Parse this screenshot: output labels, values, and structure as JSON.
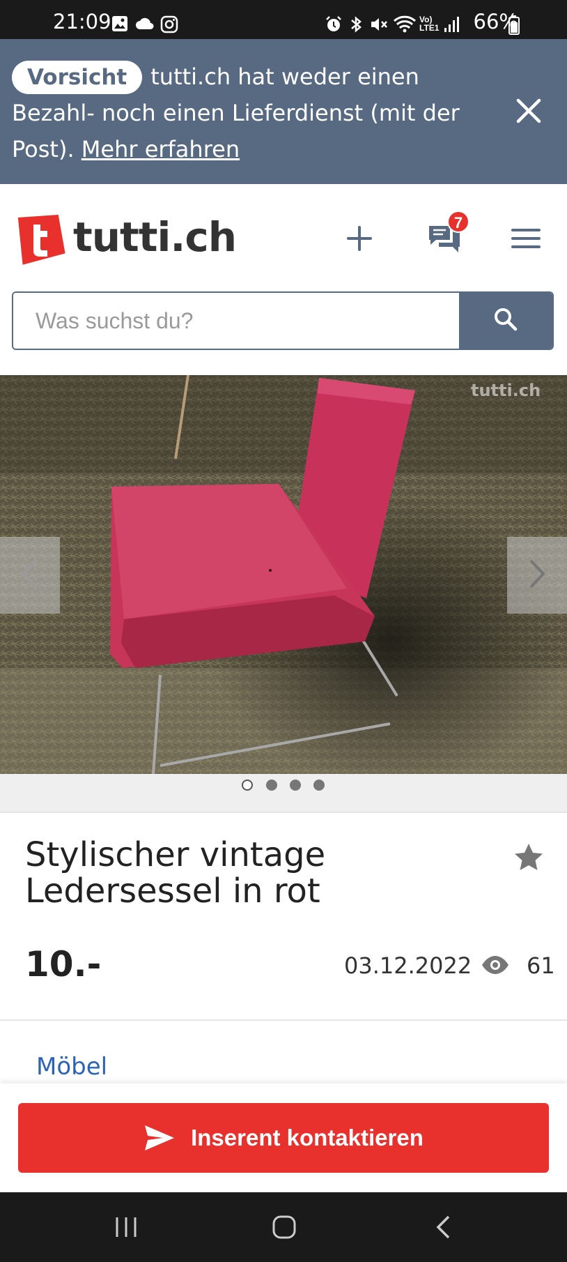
{
  "status_bar": {
    "time": "21:09",
    "right_text": "66%",
    "icons": [
      "image-icon",
      "cloud-icon",
      "instagram-icon",
      "alarm-icon",
      "bluetooth-icon",
      "mute-icon",
      "wifi-icon",
      "lte-icon",
      "signal-icon",
      "battery-icon"
    ]
  },
  "banner": {
    "badge": "Vorsicht",
    "message": "tutti.ch hat weder einen Bezahl- noch einen Lieferdienst (mit der Post).",
    "link": "Mehr erfahren",
    "close_icon": "close-icon"
  },
  "header": {
    "logo_text": "tutti.ch",
    "messages_badge": "7",
    "accent": "#e8302d"
  },
  "search": {
    "placeholder": "Was suchst du?",
    "value": ""
  },
  "gallery": {
    "watermark": "tutti.ch",
    "image_count": 4,
    "active_index": 0
  },
  "listing": {
    "title": "Stylischer vintage Ledersessel in rot",
    "price": "10.-",
    "date": "03.12.2022",
    "views": "61",
    "category": "Möbel"
  },
  "actions": {
    "contact_label": "Inserent kontaktieren"
  },
  "colors": {
    "banner_bg": "#576a82",
    "primary_red": "#e8302d",
    "link_blue": "#2b63b7"
  }
}
